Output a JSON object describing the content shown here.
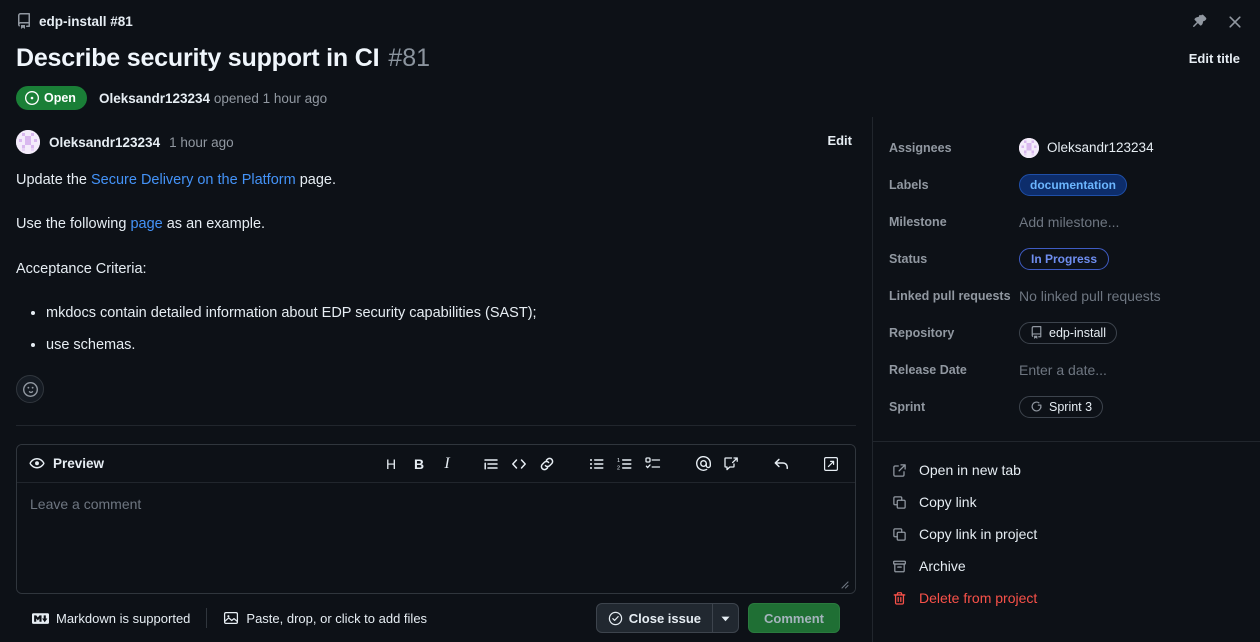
{
  "header": {
    "breadcrumb": "edp-install #81",
    "breadcrumb_icon": "repo-icon",
    "title": "Describe security support in CI",
    "issue_number": "#81",
    "state_badge": "Open",
    "state_color": "#1a7f37",
    "author": "Oleksandr123234",
    "opened_text": "opened 1 hour ago",
    "edit_title_label": "Edit title",
    "pin_icon": "pin-icon",
    "close_icon": "close-icon"
  },
  "comment": {
    "author": "Oleksandr123234",
    "timestamp": "1 hour ago",
    "edit_label": "Edit",
    "paragraph1_pre": "Update the ",
    "paragraph1_link": "Secure Delivery on the Platform",
    "paragraph1_post": " page.",
    "paragraph2_pre": "Use the following ",
    "paragraph2_link": "page",
    "paragraph2_post": " as an example.",
    "paragraph3": "Acceptance Criteria:",
    "bullets": [
      "mkdocs contain detailed information about EDP security capabilities (SAST);",
      "use schemas."
    ],
    "reaction_icon": "smiley-icon",
    "link_color": "#4493f8"
  },
  "editor": {
    "preview_label": "Preview",
    "preview_icon": "eye-icon",
    "placeholder": "Leave a comment",
    "toolbar": [
      {
        "name": "heading-icon",
        "glyph": "H"
      },
      {
        "name": "bold-icon",
        "glyph": "B"
      },
      {
        "name": "italic-icon",
        "glyph": "I"
      },
      {
        "name": "quote-icon",
        "glyph": ""
      },
      {
        "name": "code-icon",
        "glyph": ""
      },
      {
        "name": "link-icon",
        "glyph": ""
      },
      {
        "name": "unordered-list-icon",
        "glyph": ""
      },
      {
        "name": "ordered-list-icon",
        "glyph": ""
      },
      {
        "name": "task-list-icon",
        "glyph": ""
      },
      {
        "name": "mention-icon",
        "glyph": "@"
      },
      {
        "name": "saved-reply-icon",
        "glyph": ""
      },
      {
        "name": "reply-icon",
        "glyph": ""
      },
      {
        "name": "fullscreen-icon",
        "glyph": ""
      }
    ],
    "markdown_note": "Markdown is supported",
    "markdown_icon": "markdown-icon",
    "attach_note": "Paste, drop, or click to add files",
    "attach_icon": "image-icon",
    "close_issue_label": "Close issue",
    "close_issue_icon": "check-circle-icon",
    "caret_icon": "chevron-down-icon",
    "comment_label": "Comment",
    "comment_color": "#1f6f34",
    "resize_icon": "resize-grip-icon"
  },
  "sidebar": {
    "fields": [
      {
        "label": "Assignees",
        "value": "Oleksandr123234",
        "type": "avatar-user"
      },
      {
        "label": "Labels",
        "value": "documentation",
        "type": "label-chip"
      },
      {
        "label": "Milestone",
        "value": "Add milestone...",
        "type": "muted"
      },
      {
        "label": "Status",
        "value": "In Progress",
        "type": "status-chip"
      },
      {
        "label": "Linked pull requests",
        "value": "No linked pull requests",
        "type": "muted"
      },
      {
        "label": "Repository",
        "value": "edp-install",
        "type": "repo-chip"
      },
      {
        "label": "Release Date",
        "value": "Enter a date...",
        "type": "muted"
      },
      {
        "label": "Sprint",
        "value": "Sprint 3",
        "type": "iteration-chip"
      }
    ],
    "menu": [
      {
        "label": "Open in new tab",
        "icon": "external-link-icon",
        "danger": false
      },
      {
        "label": "Copy link",
        "icon": "copy-icon",
        "danger": false
      },
      {
        "label": "Copy link in project",
        "icon": "copy-icon",
        "danger": false
      },
      {
        "label": "Archive",
        "icon": "archive-icon",
        "danger": false
      },
      {
        "label": "Delete from project",
        "icon": "trash-icon",
        "danger": true
      }
    ],
    "label_color": "#6cb6ff",
    "status_color": "#6f8ef0",
    "danger_color": "#f85149"
  }
}
